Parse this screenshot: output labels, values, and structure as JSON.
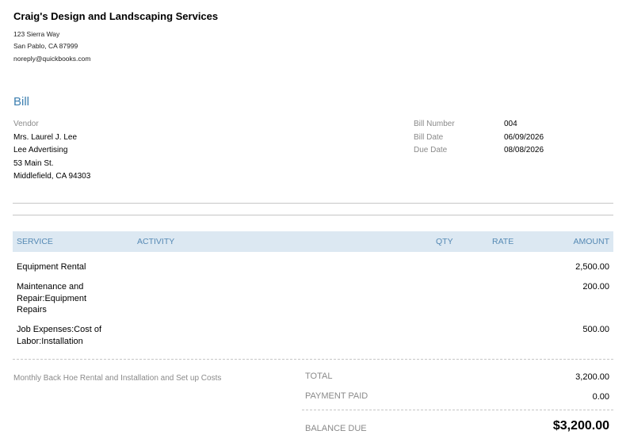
{
  "company": {
    "name": "Craig's Design and Landscaping Services",
    "street": "123 Sierra Way",
    "city_line": "San Pablo, CA  87999",
    "email": "noreply@quickbooks.com"
  },
  "document_title": "Bill",
  "vendor": {
    "label": "Vendor",
    "name": "Mrs. Laurel J. Lee",
    "company": "Lee Advertising",
    "street": "53 Main St.",
    "city_line": "Middlefield, CA  94303"
  },
  "bill_info": {
    "number_label": "Bill Number",
    "number": "004",
    "date_label": "Bill Date",
    "date": "06/09/2026",
    "due_label": "Due Date",
    "due": "08/08/2026"
  },
  "table": {
    "headers": {
      "service": "SERVICE",
      "activity": "ACTIVITY",
      "qty": "QTY",
      "rate": "RATE",
      "amount": "AMOUNT"
    },
    "rows": [
      {
        "service": "Equipment Rental",
        "amount": "2,500.00"
      },
      {
        "service": "Maintenance and Repair:Equipment Repairs",
        "amount": "200.00"
      },
      {
        "service": "Job Expenses:Cost of Labor:Installation",
        "amount": "500.00"
      }
    ]
  },
  "memo": "Monthly Back Hoe Rental and Installation and Set up Costs",
  "totals": {
    "total_label": "TOTAL",
    "total": "3,200.00",
    "paid_label": "PAYMENT PAID",
    "paid": "0.00",
    "balance_label": "BALANCE DUE",
    "balance": "$3,200.00"
  }
}
